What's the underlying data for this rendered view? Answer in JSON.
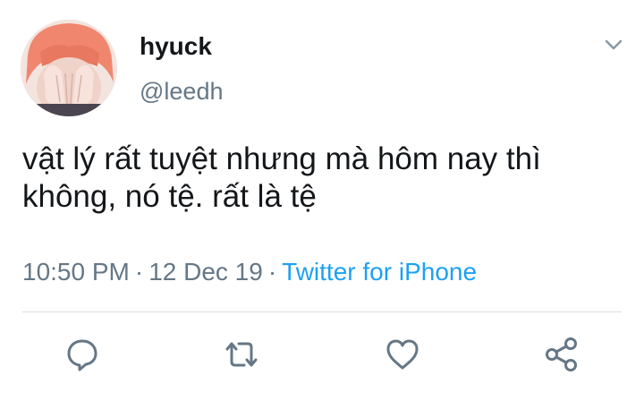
{
  "tweet": {
    "display_name": "hyuck",
    "handle": "@leedh",
    "text": "vật lý rất tuyệt nhưng mà hôm nay thì không, nó tệ. rất là tệ",
    "time": "10:50 PM",
    "date": "12 Dec 19",
    "separator": "·",
    "source": "Twitter for iPhone"
  },
  "icons": {
    "menu": "chevron-down-icon",
    "reply": "reply-icon",
    "retweet": "retweet-icon",
    "like": "heart-icon",
    "share": "share-icon"
  },
  "colors": {
    "text": "#14171a",
    "secondary": "#657786",
    "accent": "#1da1f2",
    "icon": "#657786"
  }
}
